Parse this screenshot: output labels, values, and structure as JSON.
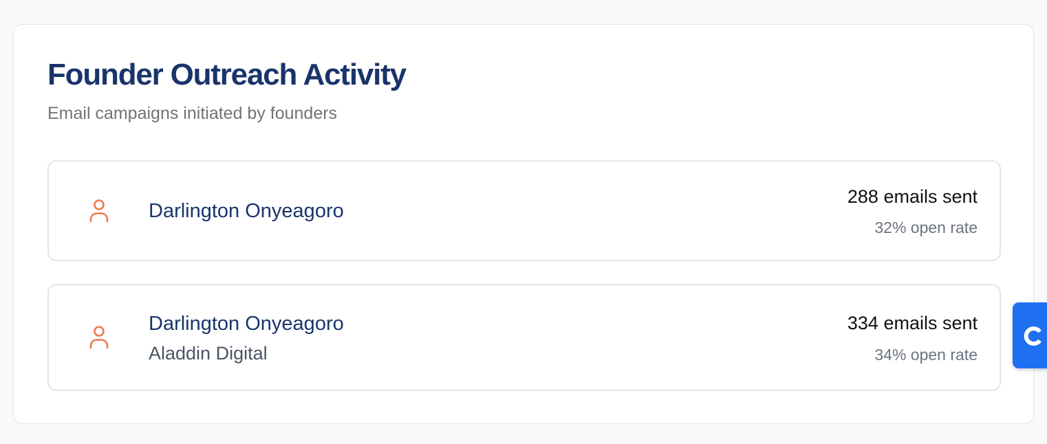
{
  "card": {
    "title": "Founder Outreach Activity",
    "subtitle": "Email campaigns initiated by founders"
  },
  "founders": [
    {
      "name": "Darlington Onyeagoro",
      "company": "",
      "emails_sent": "288 emails sent",
      "open_rate": "32% open rate"
    },
    {
      "name": "Darlington Onyeagoro",
      "company": "Aladdin Digital",
      "emails_sent": "334 emails sent",
      "open_rate": "34% open rate"
    }
  ],
  "icons": {
    "founder": "person-icon",
    "widget": "chat-widget-icon"
  },
  "colors": {
    "title": "#1a346b",
    "accent_icon": "#ee7a4e",
    "widget": "#1f6ff1"
  }
}
